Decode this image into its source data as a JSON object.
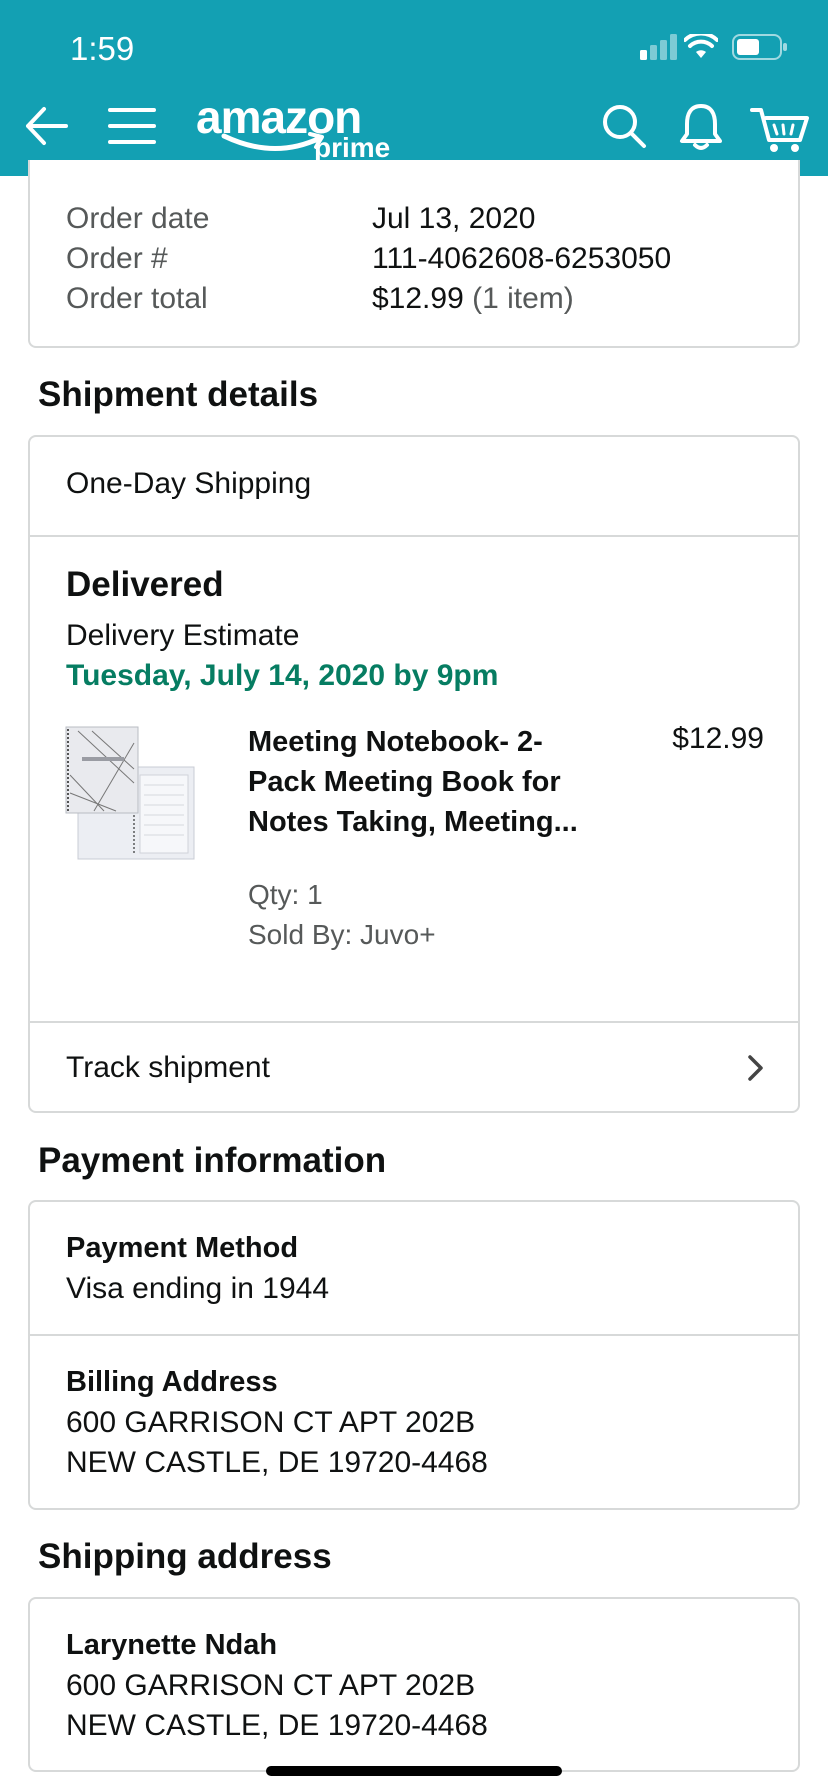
{
  "status_bar": {
    "time": "1:59"
  },
  "header": {
    "logo_word": "amazon",
    "logo_sub": "prime",
    "icons": [
      "back-arrow-icon",
      "menu-icon",
      "search-icon",
      "bell-icon",
      "cart-icon"
    ]
  },
  "order_summary": {
    "date_label": "Order date",
    "date_value": "Jul 13, 2020",
    "number_label": "Order #",
    "number_value": "111-4062608-6253050",
    "total_label": "Order total",
    "total_value": "$12.99",
    "total_items": "(1 item)"
  },
  "shipment": {
    "section_title": "Shipment details",
    "shipping_speed": "One-Day Shipping",
    "status": "Delivered",
    "estimate_label": "Delivery Estimate",
    "estimate_date": "Tuesday, July 14, 2020 by 9pm",
    "item": {
      "title": "Meeting Notebook- 2-Pack Meeting Book for Notes Taking, Meeting...",
      "price": "$12.99",
      "qty": "Qty: 1",
      "seller": "Sold By: Juvo+"
    },
    "track_label": "Track shipment"
  },
  "payment": {
    "section_title": "Payment information",
    "method_label": "Payment Method",
    "method_value": "Visa ending in 1944",
    "billing_label": "Billing Address",
    "billing_line1": "600 GARRISON CT APT 202B",
    "billing_line2": "NEW CASTLE, DE 19720-4468"
  },
  "shipping_address": {
    "section_title": "Shipping address",
    "name": "Larynette Ndah",
    "line1": "600 GARRISON CT APT 202B",
    "line2": "NEW CASTLE, DE 19720-4468"
  },
  "colors": {
    "header_bg": "#13a0b3",
    "delivery_green": "#067d62",
    "border": "#d7d9d9"
  }
}
